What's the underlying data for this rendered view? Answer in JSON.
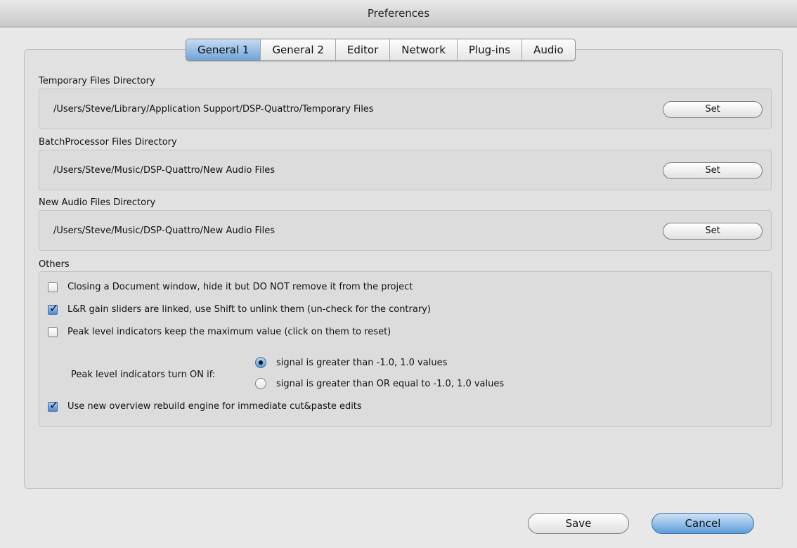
{
  "window": {
    "title": "Preferences"
  },
  "tabs": [
    {
      "label": "General 1",
      "active": true
    },
    {
      "label": "General 2",
      "active": false
    },
    {
      "label": "Editor",
      "active": false
    },
    {
      "label": "Network",
      "active": false
    },
    {
      "label": "Plug-ins",
      "active": false
    },
    {
      "label": "Audio",
      "active": false
    }
  ],
  "directories": [
    {
      "label": "Temporary Files Directory",
      "path": "/Users/Steve/Library/Application Support/DSP-Quattro/Temporary Files",
      "button": "Set"
    },
    {
      "label": "BatchProcessor Files Directory",
      "path": "/Users/Steve/Music/DSP-Quattro/New Audio Files",
      "button": "Set"
    },
    {
      "label": "New Audio Files Directory",
      "path": "/Users/Steve/Music/DSP-Quattro/New Audio Files",
      "button": "Set"
    }
  ],
  "others": {
    "label": "Others",
    "options": [
      {
        "label": "Closing a Document window, hide it but DO NOT remove it from the project",
        "checked": false
      },
      {
        "label": "L&R gain sliders are linked, use Shift to unlink them (un-check for the contrary)",
        "checked": true
      },
      {
        "label": "Peak level indicators keep the maximum value (click on them to reset)",
        "checked": false
      },
      {
        "label": "Use new overview rebuild engine for immediate cut&paste edits",
        "checked": true
      }
    ],
    "peak_turn_on": {
      "label": "Peak level indicators turn ON if:",
      "choices": [
        {
          "label": "signal is greater than -1.0, 1.0 values",
          "selected": true
        },
        {
          "label": "signal is greater than OR equal to -1.0, 1.0 values",
          "selected": false
        }
      ]
    }
  },
  "footer": {
    "save_label": "Save",
    "cancel_label": "Cancel"
  },
  "colors": {
    "accent": "#6fa3d8",
    "window_bg": "#e8e8e8"
  }
}
